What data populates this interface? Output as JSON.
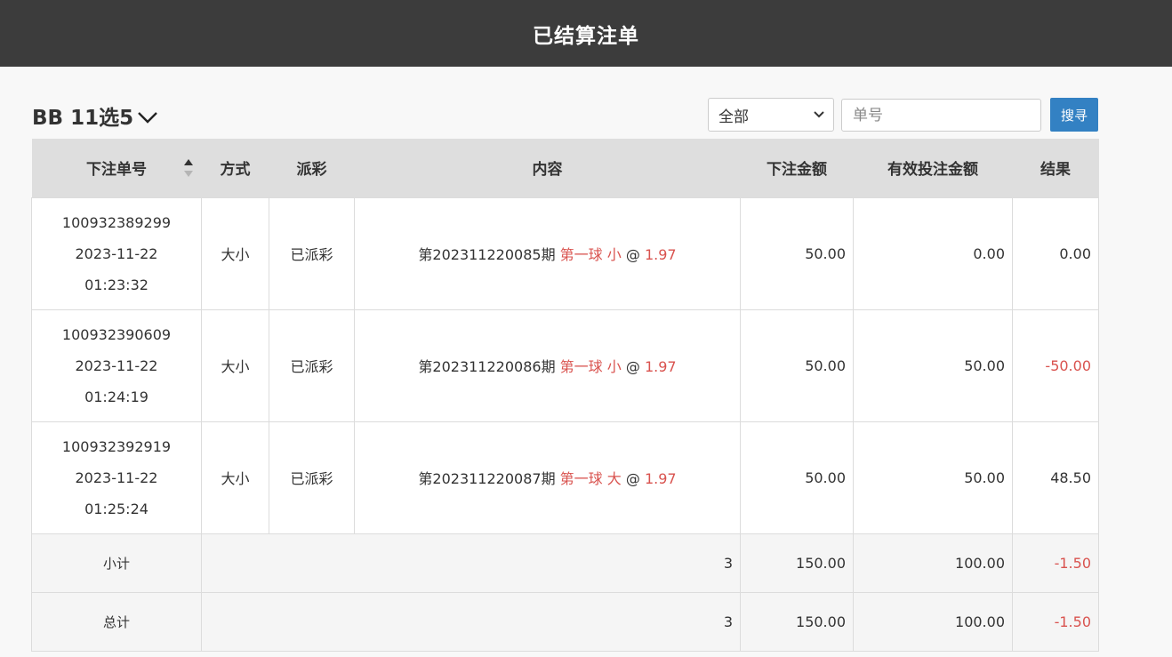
{
  "header": {
    "title": "已结算注单"
  },
  "game": {
    "title": "BB 11选5"
  },
  "filter": {
    "selected": "全部"
  },
  "search": {
    "placeholder": "单号",
    "button_label": "搜寻"
  },
  "table": {
    "columns": [
      "下注单号",
      "方式",
      "派彩",
      "内容",
      "下注金额",
      "有效投注金额",
      "结果"
    ],
    "rows": [
      {
        "order_no": "100932389299",
        "date": "2023-11-22",
        "time": "01:23:32",
        "method": "大小",
        "payout": "已派彩",
        "content_period": "第202311220085期",
        "content_bet": "第一球 小",
        "content_at": "@",
        "content_odds": "1.97",
        "amount": "50.00",
        "valid_amount": "0.00",
        "result": "0.00",
        "result_negative": false
      },
      {
        "order_no": "100932390609",
        "date": "2023-11-22",
        "time": "01:24:19",
        "method": "大小",
        "payout": "已派彩",
        "content_period": "第202311220086期",
        "content_bet": "第一球 小",
        "content_at": "@",
        "content_odds": "1.97",
        "amount": "50.00",
        "valid_amount": "50.00",
        "result": "-50.00",
        "result_negative": true
      },
      {
        "order_no": "100932392919",
        "date": "2023-11-22",
        "time": "01:25:24",
        "method": "大小",
        "payout": "已派彩",
        "content_period": "第202311220087期",
        "content_bet": "第一球 大",
        "content_at": "@",
        "content_odds": "1.97",
        "amount": "50.00",
        "valid_amount": "50.00",
        "result": "48.50",
        "result_negative": false
      }
    ],
    "subtotal": {
      "label": "小计",
      "count": "3",
      "amount": "150.00",
      "valid_amount": "100.00",
      "result": "-1.50"
    },
    "total": {
      "label": "总计",
      "count": "3",
      "amount": "150.00",
      "valid_amount": "100.00",
      "result": "-1.50"
    }
  },
  "colors": {
    "header_bg": "#3c3c3c",
    "accent": "#3381c3",
    "negative": "#d9534f",
    "table_head_bg": "#dedede"
  },
  "icons": {
    "game_dropdown": "chevron-down-icon",
    "sort": "sort-arrows-icon",
    "select": "select-chevron-icon"
  }
}
